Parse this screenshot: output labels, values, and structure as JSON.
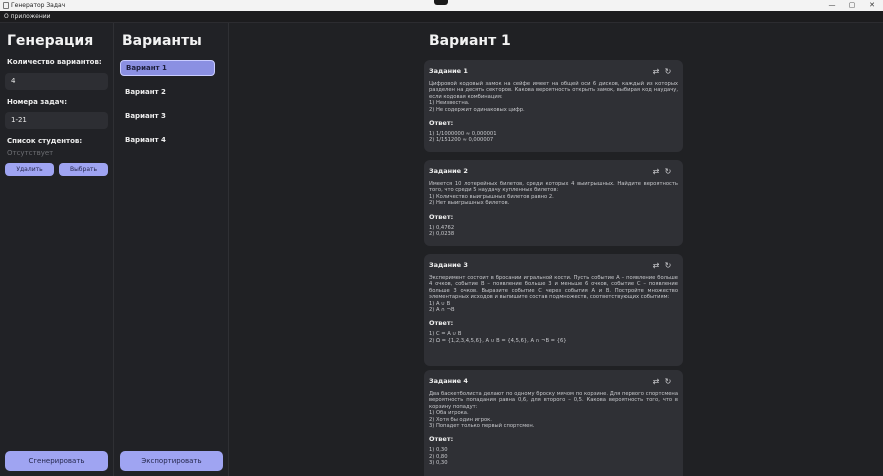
{
  "window": {
    "title": "Генератор Задач"
  },
  "window_controls": {
    "minimize": "—",
    "maximize": "▢",
    "close": "✕"
  },
  "menu": {
    "about": "О приложении"
  },
  "generation": {
    "heading": "Генерация",
    "variants_count_label": "Количество вариантов:",
    "variants_count_value": "4",
    "task_numbers_label": "Номера задач:",
    "task_numbers_value": "1-21",
    "students_label": "Список студентов:",
    "students_placeholder": "Отсутствует",
    "delete_button": "Удалить",
    "select_button": "Выбрать",
    "generate_button": "Сгенерировать"
  },
  "variants": {
    "heading": "Варианты",
    "items": [
      "Вариант 1",
      "Вариант 2",
      "Вариант 3",
      "Вариант 4"
    ],
    "selected_index": 0,
    "export_button": "Экспортировать"
  },
  "main": {
    "title": "Вариант 1",
    "tasks": [
      {
        "title": "Задание 1",
        "text": "Цифровой кодовый замок на сейфе имеет на общей оси 6 дисков, каждый из которых разделен на десять секторов. Какова вероятность открыть замок, выбирая код наудачу, если кодовая комбинация:",
        "items": [
          "1) Неизвестна.",
          "2) Не содержит одинаковых цифр."
        ],
        "answer_label": "Ответ:",
        "answers": [
          "1) 1/1000000 ≈ 0,000001",
          "2) 1/151200 ≈ 0,000007"
        ]
      },
      {
        "title": "Задание 2",
        "text": "Имеется 10 лотерейных билетов, среди которых 4 выигрышных. Найдите вероятность того, что среди 5 наудачу купленных билетов:",
        "items": [
          "1) Количество выигрышных билетов равно 2.",
          "2) Нет выигрышных билетов."
        ],
        "answer_label": "Ответ:",
        "answers": [
          "1) 0,4762",
          "2) 0,0238"
        ]
      },
      {
        "title": "Задание 3",
        "text": "Эксперимент состоит в бросании игральной кости. Пусть событие A – появление больше 4 очков, событие B – появление больше 3 и меньше 6 очков, событие C – появление больше 3 очков. Выразите событие C через события A и B. Постройте множество элементарных исходов и выпишите состав подмножеств, соответствующих событиям:",
        "items": [
          "1) A ∪ B",
          "2) A ∩ ¬B"
        ],
        "answer_label": "Ответ:",
        "answers": [
          "1) C = A ∪ B",
          "2) Ω = {1,2,3,4,5,6}, A ∪ B = {4,5,6}, A ∩ ¬B = {6}"
        ]
      },
      {
        "title": "Задание 4",
        "text": "Два баскетболиста делают по одному броску мячом по корзине. Для первого спортсмена вероятность попадания равна 0,6, для второго – 0,5. Какова вероятность того, что в корзину попадут:",
        "items": [
          "1) Оба игрока.",
          "2) Хотя бы один игрок.",
          "3) Попадет только первый спортсмен."
        ],
        "answer_label": "Ответ:",
        "answers": [
          "1) 0,30",
          "2) 0,80",
          "3) 0,30"
        ]
      }
    ]
  },
  "icons": {
    "swap": "⇄",
    "refresh": "↻",
    "app": "app-icon"
  }
}
